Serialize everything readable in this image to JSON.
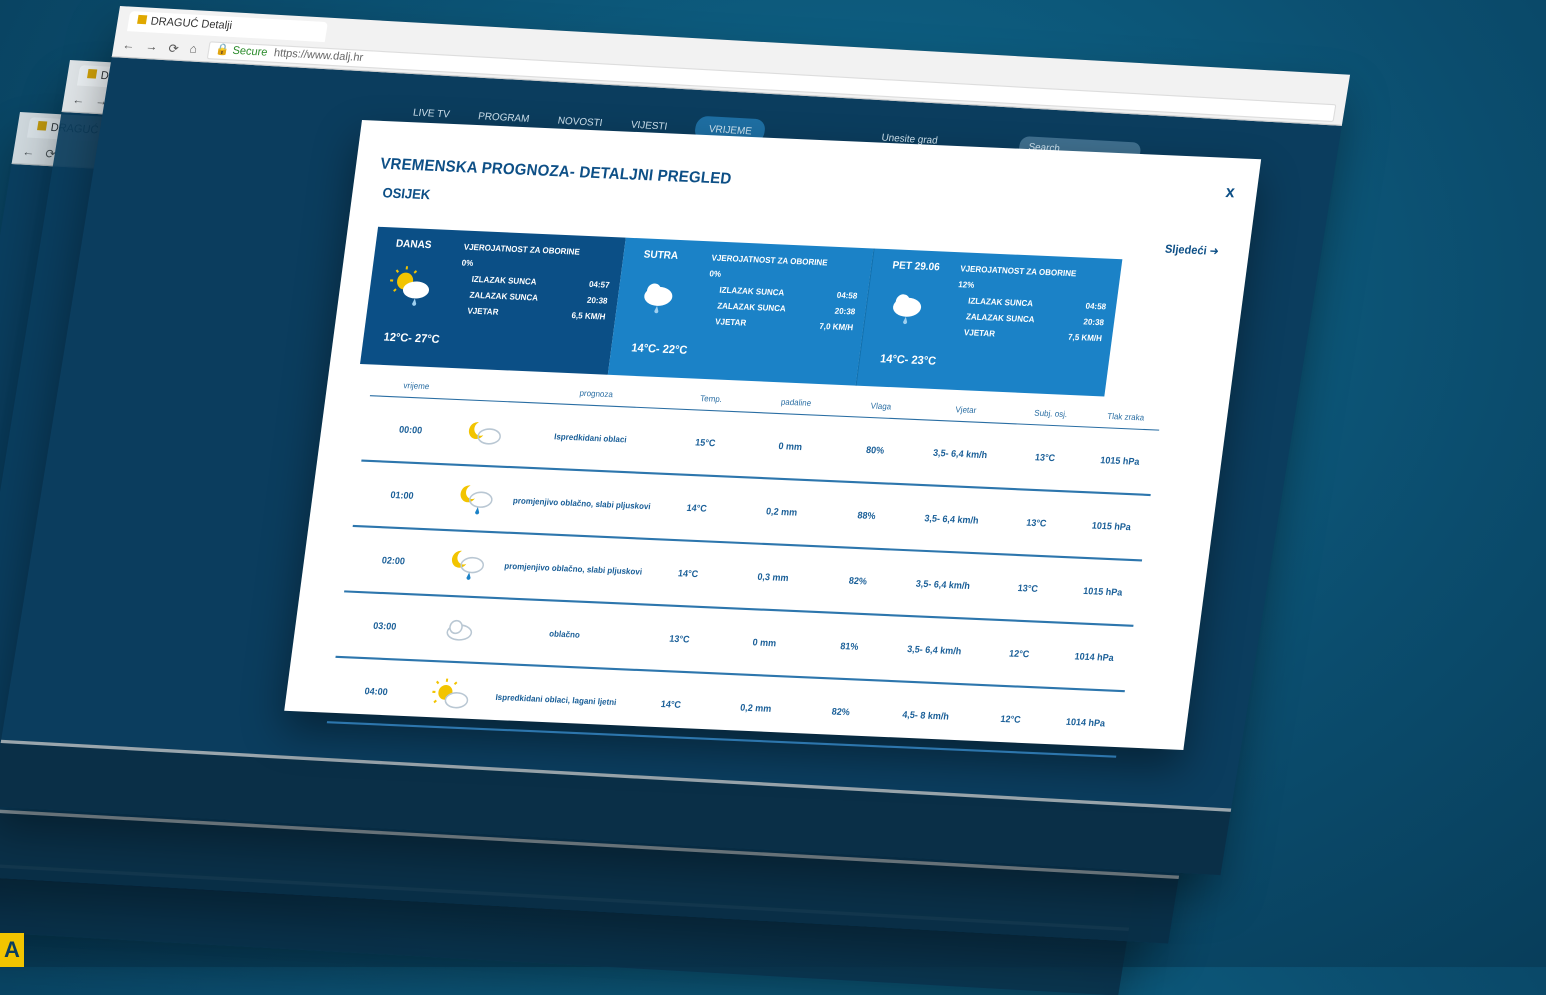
{
  "browser": {
    "tab_title": "DRAGUĆ Detalji",
    "secure_label": "Secure",
    "url": "https://www.dalj.hr"
  },
  "site": {
    "nav": [
      "LIVE TV",
      "PROGRAM",
      "NOVOSTI",
      "VIJESTI"
    ],
    "nav_active": "VRIJEME",
    "city_placeholder": "Unesite grad",
    "search_placeholder": "Search"
  },
  "modal": {
    "title": "VREMENSKA PROGNOZA- DETALJNI PREGLED",
    "city": "OSIJEK",
    "next_label": "Sljedeći",
    "close_label": "x",
    "days": [
      {
        "name": "DANAS",
        "temp": "12°C- 27°C",
        "precip_label": "VJEROJATNOST ZA OBORINE",
        "precip_value": "0%",
        "sunrise_label": "IZLAZAK SUNCA",
        "sunrise": "04:57",
        "sunset_label": "ZALAZAK SUNCA",
        "sunset": "20:38",
        "wind_label": "VJETAR",
        "wind": "6,5 KM/H",
        "icon": "sun-cloud-rain-icon"
      },
      {
        "name": "SUTRA",
        "temp": "14°C- 22°C",
        "precip_label": "VJEROJATNOST ZA OBORINE",
        "precip_value": "0%",
        "sunrise_label": "IZLAZAK SUNCA",
        "sunrise": "04:58",
        "sunset_label": "ZALAZAK SUNCA",
        "sunset": "20:38",
        "wind_label": "VJETAR",
        "wind": "7,0 KM/H",
        "icon": "cloud-rain-icon"
      },
      {
        "name": "PET 29.06",
        "temp": "14°C- 23°C",
        "precip_label": "VJEROJATNOST ZA OBORINE",
        "precip_value": "12%",
        "sunrise_label": "IZLAZAK SUNCA",
        "sunrise": "04:58",
        "sunset_label": "ZALAZAK SUNCA",
        "sunset": "20:38",
        "wind_label": "VJETAR",
        "wind": "7,5 KM/H",
        "icon": "cloud-rain-icon"
      }
    ],
    "columns": [
      "vrijeme",
      "prognoza",
      "Temp.",
      "padaline",
      "Vlaga",
      "Vjetar",
      "Subj. osj.",
      "Tlak zraka"
    ],
    "rows": [
      {
        "time": "00:00",
        "icon": "moon-cloud-icon",
        "forecast": "Ispredkidani oblaci",
        "temp": "15°C",
        "precip": "0 mm",
        "humidity": "80%",
        "wind": "3,5- 6,4 km/h",
        "feel": "13°C",
        "pressure": "1015 hPa"
      },
      {
        "time": "01:00",
        "icon": "moon-cloud-rain-icon",
        "forecast": "promjenjivo oblačno, slabi pljuskovi",
        "temp": "14°C",
        "precip": "0,2 mm",
        "humidity": "88%",
        "wind": "3,5- 6,4 km/h",
        "feel": "13°C",
        "pressure": "1015 hPa"
      },
      {
        "time": "02:00",
        "icon": "moon-cloud-rain-icon",
        "forecast": "promjenjivo oblačno, slabi pljuskovi",
        "temp": "14°C",
        "precip": "0,3 mm",
        "humidity": "82%",
        "wind": "3,5- 6,4 km/h",
        "feel": "13°C",
        "pressure": "1015 hPa"
      },
      {
        "time": "03:00",
        "icon": "cloud-icon",
        "forecast": "oblačno",
        "temp": "13°C",
        "precip": "0 mm",
        "humidity": "81%",
        "wind": "3,5- 6,4 km/h",
        "feel": "12°C",
        "pressure": "1014 hPa"
      },
      {
        "time": "04:00",
        "icon": "sun-cloud-icon",
        "forecast": "Ispredkidani oblaci, lagani ljetni",
        "temp": "14°C",
        "precip": "0,2 mm",
        "humidity": "82%",
        "wind": "4,5- 8 km/h",
        "feel": "12°C",
        "pressure": "1014 hPa"
      }
    ]
  },
  "colors": {
    "primary": "#0b4f86",
    "accent": "#1b82c7",
    "background": "#0b4d6e",
    "sun": "#f2c400"
  },
  "badge": "A"
}
